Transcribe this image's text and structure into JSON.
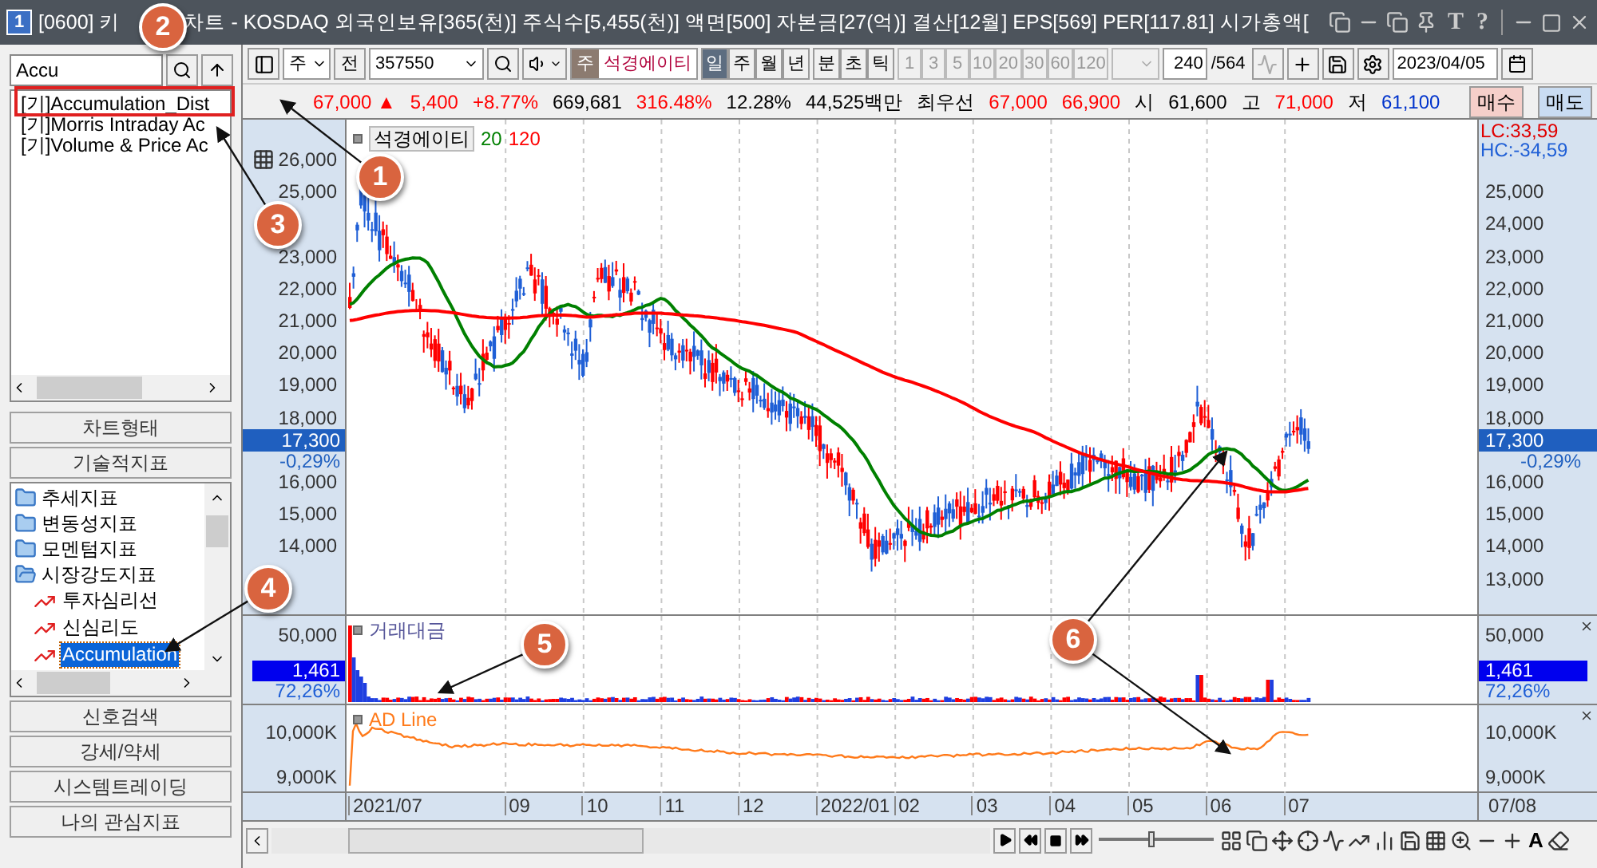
{
  "window": {
    "badge": "1",
    "title_parts": [
      "[0600] 키",
      "차트 - KOSDAQ 외국인보유[365(천)] 주식수[5,455(천)] 액면[500] 자본금[27(억)] 결산[12월] EPS[569] PER[117.81] 시가총액["
    ],
    "glyph_buttons": [
      "T",
      "?"
    ]
  },
  "sidebar": {
    "search": {
      "value": "Accu"
    },
    "results": [
      {
        "label": "[기]Accumulation_Dist"
      },
      {
        "label": "[기]Morris Intraday Ac"
      },
      {
        "label": "[기]Volume & Price Ac"
      }
    ],
    "sections": [
      "차트형태",
      "기술적지표"
    ],
    "tree": [
      {
        "label": "추세지표",
        "kind": "folder",
        "expanded": false
      },
      {
        "label": "변동성지표",
        "kind": "folder",
        "expanded": false
      },
      {
        "label": "모멘텀지표",
        "kind": "folder",
        "expanded": false
      },
      {
        "label": "시장강도지표",
        "kind": "folder",
        "expanded": true,
        "children": [
          {
            "label": "투자심리선",
            "kind": "indicator",
            "selected": false
          },
          {
            "label": "신심리도",
            "kind": "indicator",
            "selected": false
          },
          {
            "label": "Accumulation",
            "kind": "indicator",
            "selected": true
          }
        ]
      }
    ],
    "bottom_sections": [
      "신호검색",
      "강세/약세",
      "시스템트레이딩",
      "나의 관심지표"
    ]
  },
  "toolbar": {
    "market": "주",
    "prev": "전",
    "code": "357550",
    "stock_tag": "주",
    "stock_name": "석경에이티",
    "periods": [
      {
        "label": "일",
        "selected": true
      },
      {
        "label": "주",
        "selected": false
      },
      {
        "label": "월",
        "selected": false
      },
      {
        "label": "년",
        "selected": false
      },
      {
        "label": "분",
        "selected": false
      },
      {
        "label": "초",
        "selected": false
      },
      {
        "label": "틱",
        "selected": false
      }
    ],
    "intervals": [
      {
        "label": "1",
        "disabled": true
      },
      {
        "label": "3",
        "disabled": true
      },
      {
        "label": "5",
        "disabled": true
      },
      {
        "label": "10",
        "disabled": true
      },
      {
        "label": "20",
        "disabled": true
      },
      {
        "label": "30",
        "disabled": true
      },
      {
        "label": "60",
        "disabled": true
      },
      {
        "label": "120",
        "disabled": true
      }
    ],
    "count": "240",
    "total": "/564",
    "date": "2023/04/05"
  },
  "quote": [
    {
      "text": "67,000 ▲",
      "color": "#ff0000"
    },
    {
      "text": "5,400",
      "color": "#ff0000"
    },
    {
      "text": "+8.77%",
      "color": "#ff0000"
    },
    {
      "text": "669,681",
      "color": "#000000"
    },
    {
      "text": "316.48%",
      "color": "#ff0000"
    },
    {
      "text": "12.28%",
      "color": "#000000"
    },
    {
      "text": "44,525백만",
      "color": "#000000"
    },
    {
      "text": "최우선",
      "color": "#000000"
    },
    {
      "text": "67,000",
      "color": "#ff0000"
    },
    {
      "text": "66,900",
      "color": "#ff0000"
    },
    {
      "text": "시",
      "color": "#000000"
    },
    {
      "text": "61,600",
      "color": "#000000"
    },
    {
      "text": "고",
      "color": "#000000"
    },
    {
      "text": "71,000",
      "color": "#ff0000"
    },
    {
      "text": "저",
      "color": "#000000"
    },
    {
      "text": "61,100",
      "color": "#0033cc"
    }
  ],
  "trade_buttons": [
    {
      "label": "매수",
      "kind": "buy"
    },
    {
      "label": "매도",
      "kind": "sell"
    }
  ],
  "chart": {
    "legend": {
      "name": "석경에이티",
      "ma": [
        {
          "label": "20",
          "color": "#008000"
        },
        {
          "label": "120",
          "color": "#ff0000"
        }
      ]
    },
    "price_axes": [
      {
        "kind": "left",
        "ticks": [
          "26,000",
          "25,000",
          "23,000",
          "22,000",
          "21,000",
          "20,000",
          "19,000",
          "18,000",
          "16,000",
          "15,000",
          "14,000"
        ],
        "price": "17,300",
        "change": "-0,29%"
      },
      {
        "kind": "right",
        "ticks": [
          "25,000",
          "24,000",
          "23,000",
          "22,000",
          "21,000",
          "20,000",
          "19,000",
          "18,000",
          "16,000",
          "15,000",
          "14,000",
          "13,000"
        ],
        "price": "17,300",
        "change": "-0,29%"
      }
    ],
    "lc": "LC:33,59",
    "hc": "HC:-34,59",
    "volume": {
      "title": "거래대금",
      "axes": [
        {
          "kind": "left",
          "tick": "50,000",
          "current": "1,461",
          "ratio": "72,26%"
        },
        {
          "kind": "right",
          "tick": "50,000",
          "current": "1,461",
          "ratio": "72,26%"
        }
      ]
    },
    "ad": {
      "title": "AD Line",
      "axes": [
        {
          "kind": "left",
          "ticks": [
            "10,000K",
            "9,000K"
          ]
        },
        {
          "kind": "right",
          "ticks": [
            "10,000K",
            "9,000K"
          ]
        }
      ]
    },
    "months": [
      "2021/07",
      "09",
      "10",
      "11",
      "12",
      "2022/01",
      "02",
      "03",
      "04",
      "05",
      "06",
      "07"
    ],
    "last_date": "07/08"
  },
  "bottom": {
    "font_button": "A",
    "zoom_slider": {
      "level": 0.45
    }
  },
  "annotations": [
    {
      "label": "1"
    },
    {
      "label": "2"
    },
    {
      "label": "3"
    },
    {
      "label": "4"
    },
    {
      "label": "5"
    },
    {
      "label": "6"
    }
  ]
}
